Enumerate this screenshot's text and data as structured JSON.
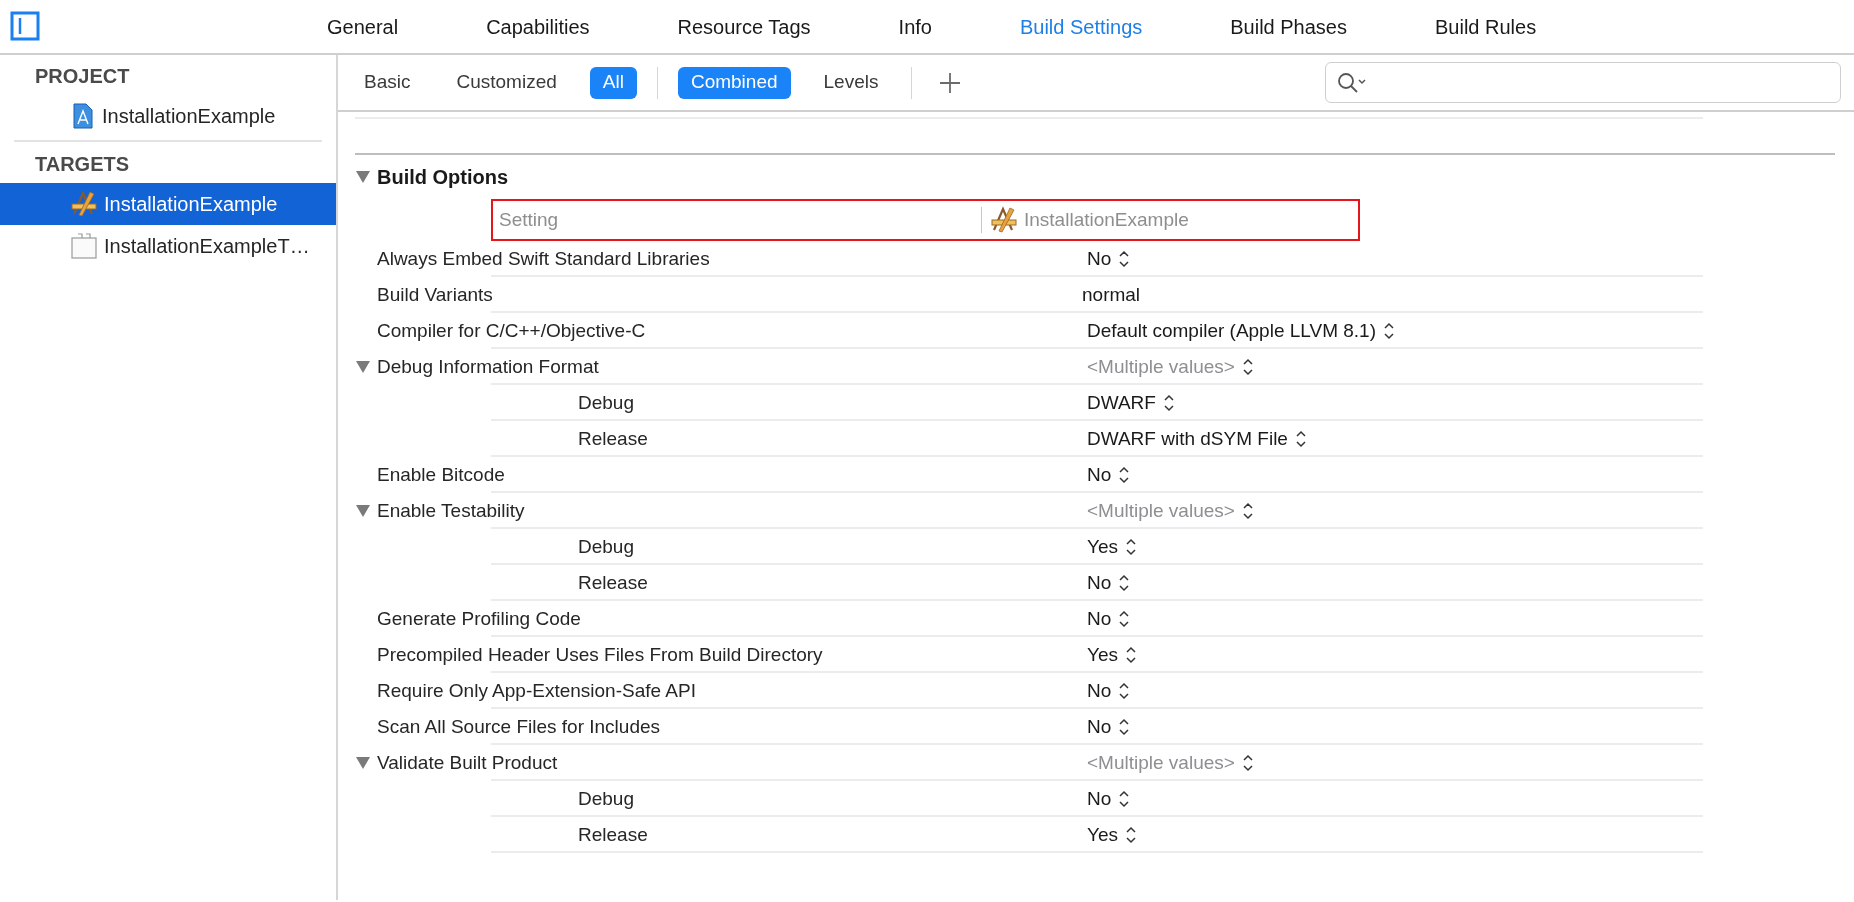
{
  "top_tabs": [
    {
      "label": "General",
      "selected": false
    },
    {
      "label": "Capabilities",
      "selected": false
    },
    {
      "label": "Resource Tags",
      "selected": false
    },
    {
      "label": "Info",
      "selected": false
    },
    {
      "label": "Build Settings",
      "selected": true
    },
    {
      "label": "Build Phases",
      "selected": false
    },
    {
      "label": "Build Rules",
      "selected": false
    }
  ],
  "sidebar": {
    "sections": [
      {
        "title": "PROJECT",
        "items": [
          {
            "label": "InstallationExample",
            "kind": "project",
            "selected": false
          }
        ]
      },
      {
        "title": "TARGETS",
        "items": [
          {
            "label": "InstallationExample",
            "kind": "app",
            "selected": true
          },
          {
            "label": "InstallationExampleT…",
            "kind": "tests",
            "selected": false
          }
        ]
      }
    ]
  },
  "filter_bar": {
    "scope_buttons": [
      {
        "label": "Basic",
        "selected": false
      },
      {
        "label": "Customized",
        "selected": false
      },
      {
        "label": "All",
        "selected": true
      }
    ],
    "view_buttons": [
      {
        "label": "Combined",
        "selected": true
      },
      {
        "label": "Levels",
        "selected": false
      }
    ]
  },
  "section": {
    "title": "Build Options",
    "expanded": true,
    "header": {
      "setting": "Setting",
      "target": "InstallationExample"
    },
    "rows": [
      {
        "label": "Always Embed Swift Standard Libraries",
        "value": "No",
        "kind": "popup"
      },
      {
        "label": "Build Variants",
        "value": "normal",
        "kind": "text"
      },
      {
        "label": "Compiler for C/C++/Objective-C",
        "value": "Default compiler (Apple LLVM 8.1)",
        "kind": "popup"
      },
      {
        "label": "Debug Information Format",
        "value": "<Multiple values>",
        "kind": "multiple",
        "expanded": true,
        "children": [
          {
            "label": "Debug",
            "value": "DWARF",
            "kind": "popup"
          },
          {
            "label": "Release",
            "value": "DWARF with dSYM File",
            "kind": "popup"
          }
        ]
      },
      {
        "label": "Enable Bitcode",
        "value": "No",
        "kind": "popup"
      },
      {
        "label": "Enable Testability",
        "value": "<Multiple values>",
        "kind": "multiple",
        "expanded": true,
        "children": [
          {
            "label": "Debug",
            "value": "Yes",
            "kind": "popup"
          },
          {
            "label": "Release",
            "value": "No",
            "kind": "popup"
          }
        ]
      },
      {
        "label": "Generate Profiling Code",
        "value": "No",
        "kind": "popup"
      },
      {
        "label": "Precompiled Header Uses Files From Build Directory",
        "value": "Yes",
        "kind": "popup"
      },
      {
        "label": "Require Only App-Extension-Safe API",
        "value": "No",
        "kind": "popup"
      },
      {
        "label": "Scan All Source Files for Includes",
        "value": "No",
        "kind": "popup"
      },
      {
        "label": "Validate Built Product",
        "value": "<Multiple values>",
        "kind": "multiple",
        "expanded": true,
        "children": [
          {
            "label": "Debug",
            "value": "No",
            "kind": "popup"
          },
          {
            "label": "Release",
            "value": "Yes",
            "kind": "popup"
          }
        ]
      }
    ]
  }
}
